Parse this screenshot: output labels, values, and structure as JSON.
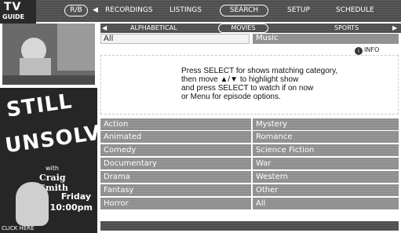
{
  "logo": {
    "line1": "TV",
    "line2": "GUIDE"
  },
  "top_nav": {
    "active_left": "R/B",
    "items": [
      "RECORDINGS",
      "LISTINGS",
      "SEARCH",
      "SETUP",
      "SCHEDULE"
    ],
    "selected": "SEARCH"
  },
  "sub_tabs": {
    "items": [
      "ALPHABETICAL",
      "MOVIES",
      "SPORTS"
    ],
    "selected": "MOVIES"
  },
  "fields": {
    "category": "All",
    "secondary": "Music"
  },
  "info": {
    "label": "INFO"
  },
  "instructions": {
    "line1": "Press SELECT for shows matching category,",
    "line2": "then move ▲/▼ to highlight show",
    "line3": "and press SELECT to watch if on now",
    "line4": "or Menu for episode options."
  },
  "genres_left": [
    "Action",
    "Animated",
    "Comedy",
    "Documentary",
    "Drama",
    "Fantasy",
    "Horror"
  ],
  "genres_right": [
    "Mystery",
    "Romance",
    "Science Fiction",
    "War",
    "Western",
    "Other",
    "All"
  ],
  "ad": {
    "title_line1": "STILL",
    "title_line2": "UNSOLVED",
    "with": "with",
    "host": "Craig Smith",
    "day": "Friday",
    "time": "10:00pm",
    "click": "CLICK HERE"
  },
  "colors": {
    "panel": "#8e8e8e",
    "dark": "#4e4e4e",
    "background": "#ffffff"
  }
}
